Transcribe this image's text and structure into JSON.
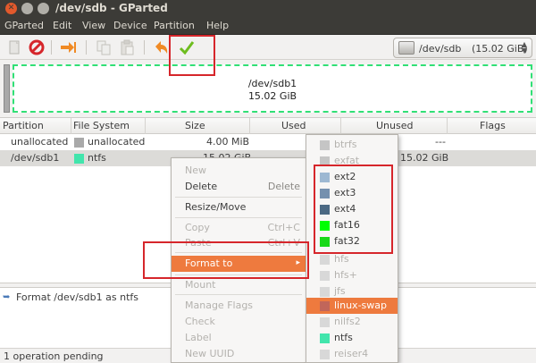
{
  "window": {
    "title": "/dev/sdb - GParted"
  },
  "menubar": [
    "GParted",
    "Edit",
    "View",
    "Device",
    "Partition",
    "Help"
  ],
  "toolbar": {
    "icons": [
      "new-partition-icon",
      "delete-partition-icon",
      "resize-move-icon",
      "copy-icon",
      "paste-icon",
      "undo-icon",
      "apply-icon"
    ],
    "device_selector": {
      "device": "/dev/sdb",
      "size": "(15.02 GiB)"
    }
  },
  "disk_map": {
    "partition_name": "/dev/sdb1",
    "partition_size": "15.02 GiB",
    "partition_border_color": "#31e076",
    "unallocated_color": "#a9a9a9"
  },
  "table": {
    "headers": [
      "Partition",
      "File System",
      "Size",
      "Used",
      "Unused",
      "Flags"
    ],
    "rows": [
      {
        "partition": "unallocated",
        "filesystem": "unallocated",
        "fs_color": "#a9a9a9",
        "size": "4.00 MiB",
        "used": "",
        "unused": "---",
        "flags": ""
      },
      {
        "partition": "/dev/sdb1",
        "filesystem": "ntfs",
        "fs_color": "#42e5ac",
        "size": "15.02 GiB",
        "used": "",
        "unused": "15.02 GiB",
        "flags": ""
      }
    ]
  },
  "context_menu": {
    "items": [
      {
        "label": "New",
        "accel": "",
        "enabled": false
      },
      {
        "label": "Delete",
        "accel": "Delete",
        "enabled": true
      },
      {
        "label": "Resize/Move",
        "accel": "",
        "enabled": true
      },
      {
        "label": "Copy",
        "accel": "Ctrl+C",
        "enabled": false
      },
      {
        "label": "Paste",
        "accel": "Ctrl+V",
        "enabled": false
      },
      {
        "label": "Format to",
        "accel": "",
        "enabled": true,
        "highlighted": true
      },
      {
        "label": "Mount",
        "accel": "",
        "enabled": false
      },
      {
        "label": "Manage Flags",
        "accel": "",
        "enabled": false
      },
      {
        "label": "Check",
        "accel": "",
        "enabled": false
      },
      {
        "label": "Label",
        "accel": "",
        "enabled": false
      },
      {
        "label": "New UUID",
        "accel": "",
        "enabled": false
      }
    ]
  },
  "format_submenu": {
    "items": [
      {
        "label": "btrfs",
        "color": "#c5c5c5",
        "enabled": false
      },
      {
        "label": "exfat",
        "color": "#c5c5c5",
        "enabled": false
      },
      {
        "label": "ext2",
        "color": "#9db8d2",
        "enabled": true
      },
      {
        "label": "ext3",
        "color": "#7590ae",
        "enabled": true
      },
      {
        "label": "ext4",
        "color": "#4b6983",
        "enabled": true
      },
      {
        "label": "fat16",
        "color": "#00ff00",
        "enabled": true
      },
      {
        "label": "fat32",
        "color": "#18d918",
        "enabled": true
      },
      {
        "label": "hfs",
        "color": "#d8d8d8",
        "enabled": false
      },
      {
        "label": "hfs+",
        "color": "#d8d8d8",
        "enabled": false
      },
      {
        "label": "jfs",
        "color": "#d8d8d8",
        "enabled": false
      },
      {
        "label": "linux-swap",
        "color": "#c1665a",
        "enabled": true,
        "highlighted": true
      },
      {
        "label": "nilfs2",
        "color": "#d8d8d8",
        "enabled": false
      },
      {
        "label": "ntfs",
        "color": "#42e5ac",
        "enabled": true
      },
      {
        "label": "reiser4",
        "color": "#d8d8d8",
        "enabled": false
      }
    ]
  },
  "pending_operations": [
    "Format /dev/sdb1 as ntfs"
  ],
  "statusbar": {
    "text": "1 operation pending"
  },
  "annotation_color": "#d6262b"
}
